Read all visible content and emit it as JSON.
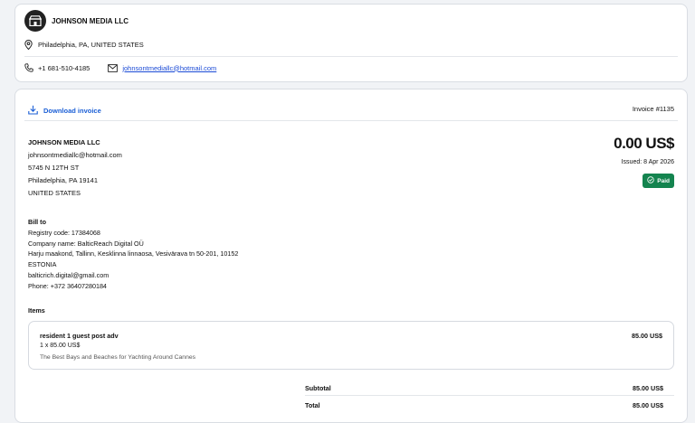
{
  "company": {
    "name": "JOHNSON MEDIA LLC",
    "location": "Philadelphia, PA, UNITED STATES",
    "phone": "+1 681-510-4185",
    "email": "johnsontmediallc@hotmail.com"
  },
  "invoice": {
    "download_label": "Download invoice",
    "number": "Invoice #1135",
    "amount": "0.00 US$",
    "issued": "Issued: 8 Apr 2026",
    "status": "Paid"
  },
  "from": {
    "name": "JOHNSON MEDIA LLC",
    "email": "johnsontmediallc@hotmail.com",
    "street": "5745 N 12TH ST",
    "city": "Philadelphia, PA 19141",
    "country": "UNITED STATES"
  },
  "bill_to": {
    "title": "Bill to",
    "registry": "Registry code: 17384068",
    "company": "Company name: BalticReach Digital OÜ",
    "address": "Harju maakond, Tallinn, Kesklinna linnaosa, Vesivärava tn 50-201, 10152",
    "country": "ESTONIA",
    "email": "balticrich.digital@gmail.com",
    "phone": "Phone: +372 36407280184"
  },
  "items": {
    "title": "Items",
    "list": [
      {
        "name": "resident 1 guest post adv",
        "qty": "1 x 85.00 US$",
        "description": "The Best Bays and Beaches for Yachting Around Cannes",
        "price": "85.00 US$"
      }
    ]
  },
  "summary": {
    "subtotal_label": "Subtotal",
    "subtotal": "85.00 US$",
    "total_label": "Total",
    "total": "85.00 US$"
  },
  "colors": {
    "accent": "#1b5fd6",
    "paid": "#14844f"
  },
  "icons": [
    "store-icon",
    "location-pin-icon",
    "phone-icon",
    "mail-icon",
    "download-icon",
    "check-circle-icon"
  ]
}
